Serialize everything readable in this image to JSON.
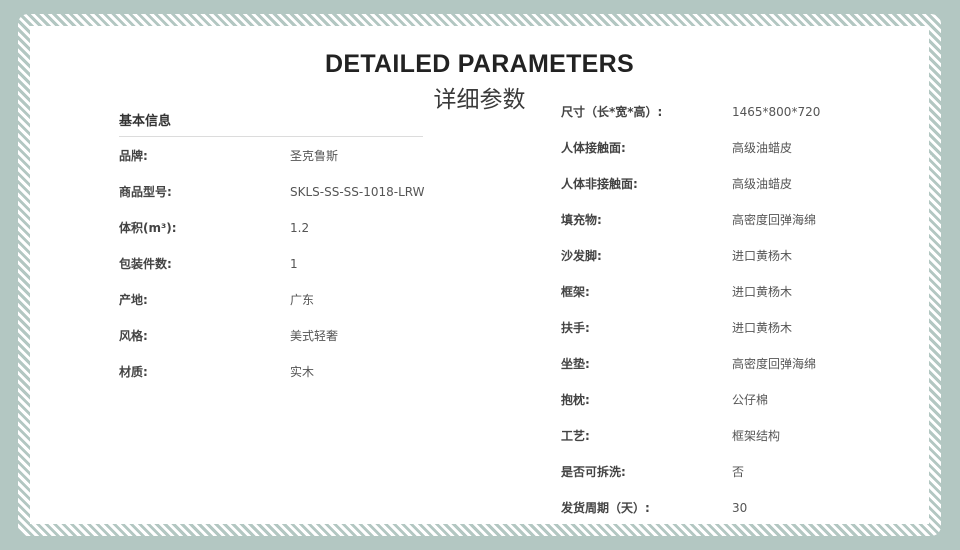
{
  "title_en": "DETAILED PARAMETERS",
  "title_cn": "详细参数",
  "basic": {
    "heading": "基本信息",
    "rows": [
      {
        "label": "品牌:",
        "value": "圣克鲁斯"
      },
      {
        "label": "商品型号:",
        "value": "SKLS-SS-SS-1018-LRW"
      },
      {
        "label": "体积(m³):",
        "value": "1.2"
      },
      {
        "label": "包装件数:",
        "value": "1"
      },
      {
        "label": "产地:",
        "value": "广东"
      },
      {
        "label": "风格:",
        "value": "美式轻奢"
      },
      {
        "label": "材质:",
        "value": "实木"
      }
    ]
  },
  "specs": {
    "rows": [
      {
        "label": "尺寸（长*宽*高）:",
        "value": "1465*800*720"
      },
      {
        "label": "人体接触面:",
        "value": "高级油蜡皮"
      },
      {
        "label": "人体非接触面:",
        "value": "高级油蜡皮"
      },
      {
        "label": "填充物:",
        "value": "高密度回弹海绵"
      },
      {
        "label": "沙发脚:",
        "value": "进口黄杨木"
      },
      {
        "label": "框架:",
        "value": "进口黄杨木"
      },
      {
        "label": "扶手:",
        "value": "进口黄杨木"
      },
      {
        "label": "坐垫:",
        "value": "高密度回弹海绵"
      },
      {
        "label": "抱枕:",
        "value": "公仔棉"
      },
      {
        "label": "工艺:",
        "value": "框架结构"
      },
      {
        "label": "是否可拆洗:",
        "value": "否"
      },
      {
        "label": "发货周期（天）:",
        "value": "30"
      }
    ]
  }
}
